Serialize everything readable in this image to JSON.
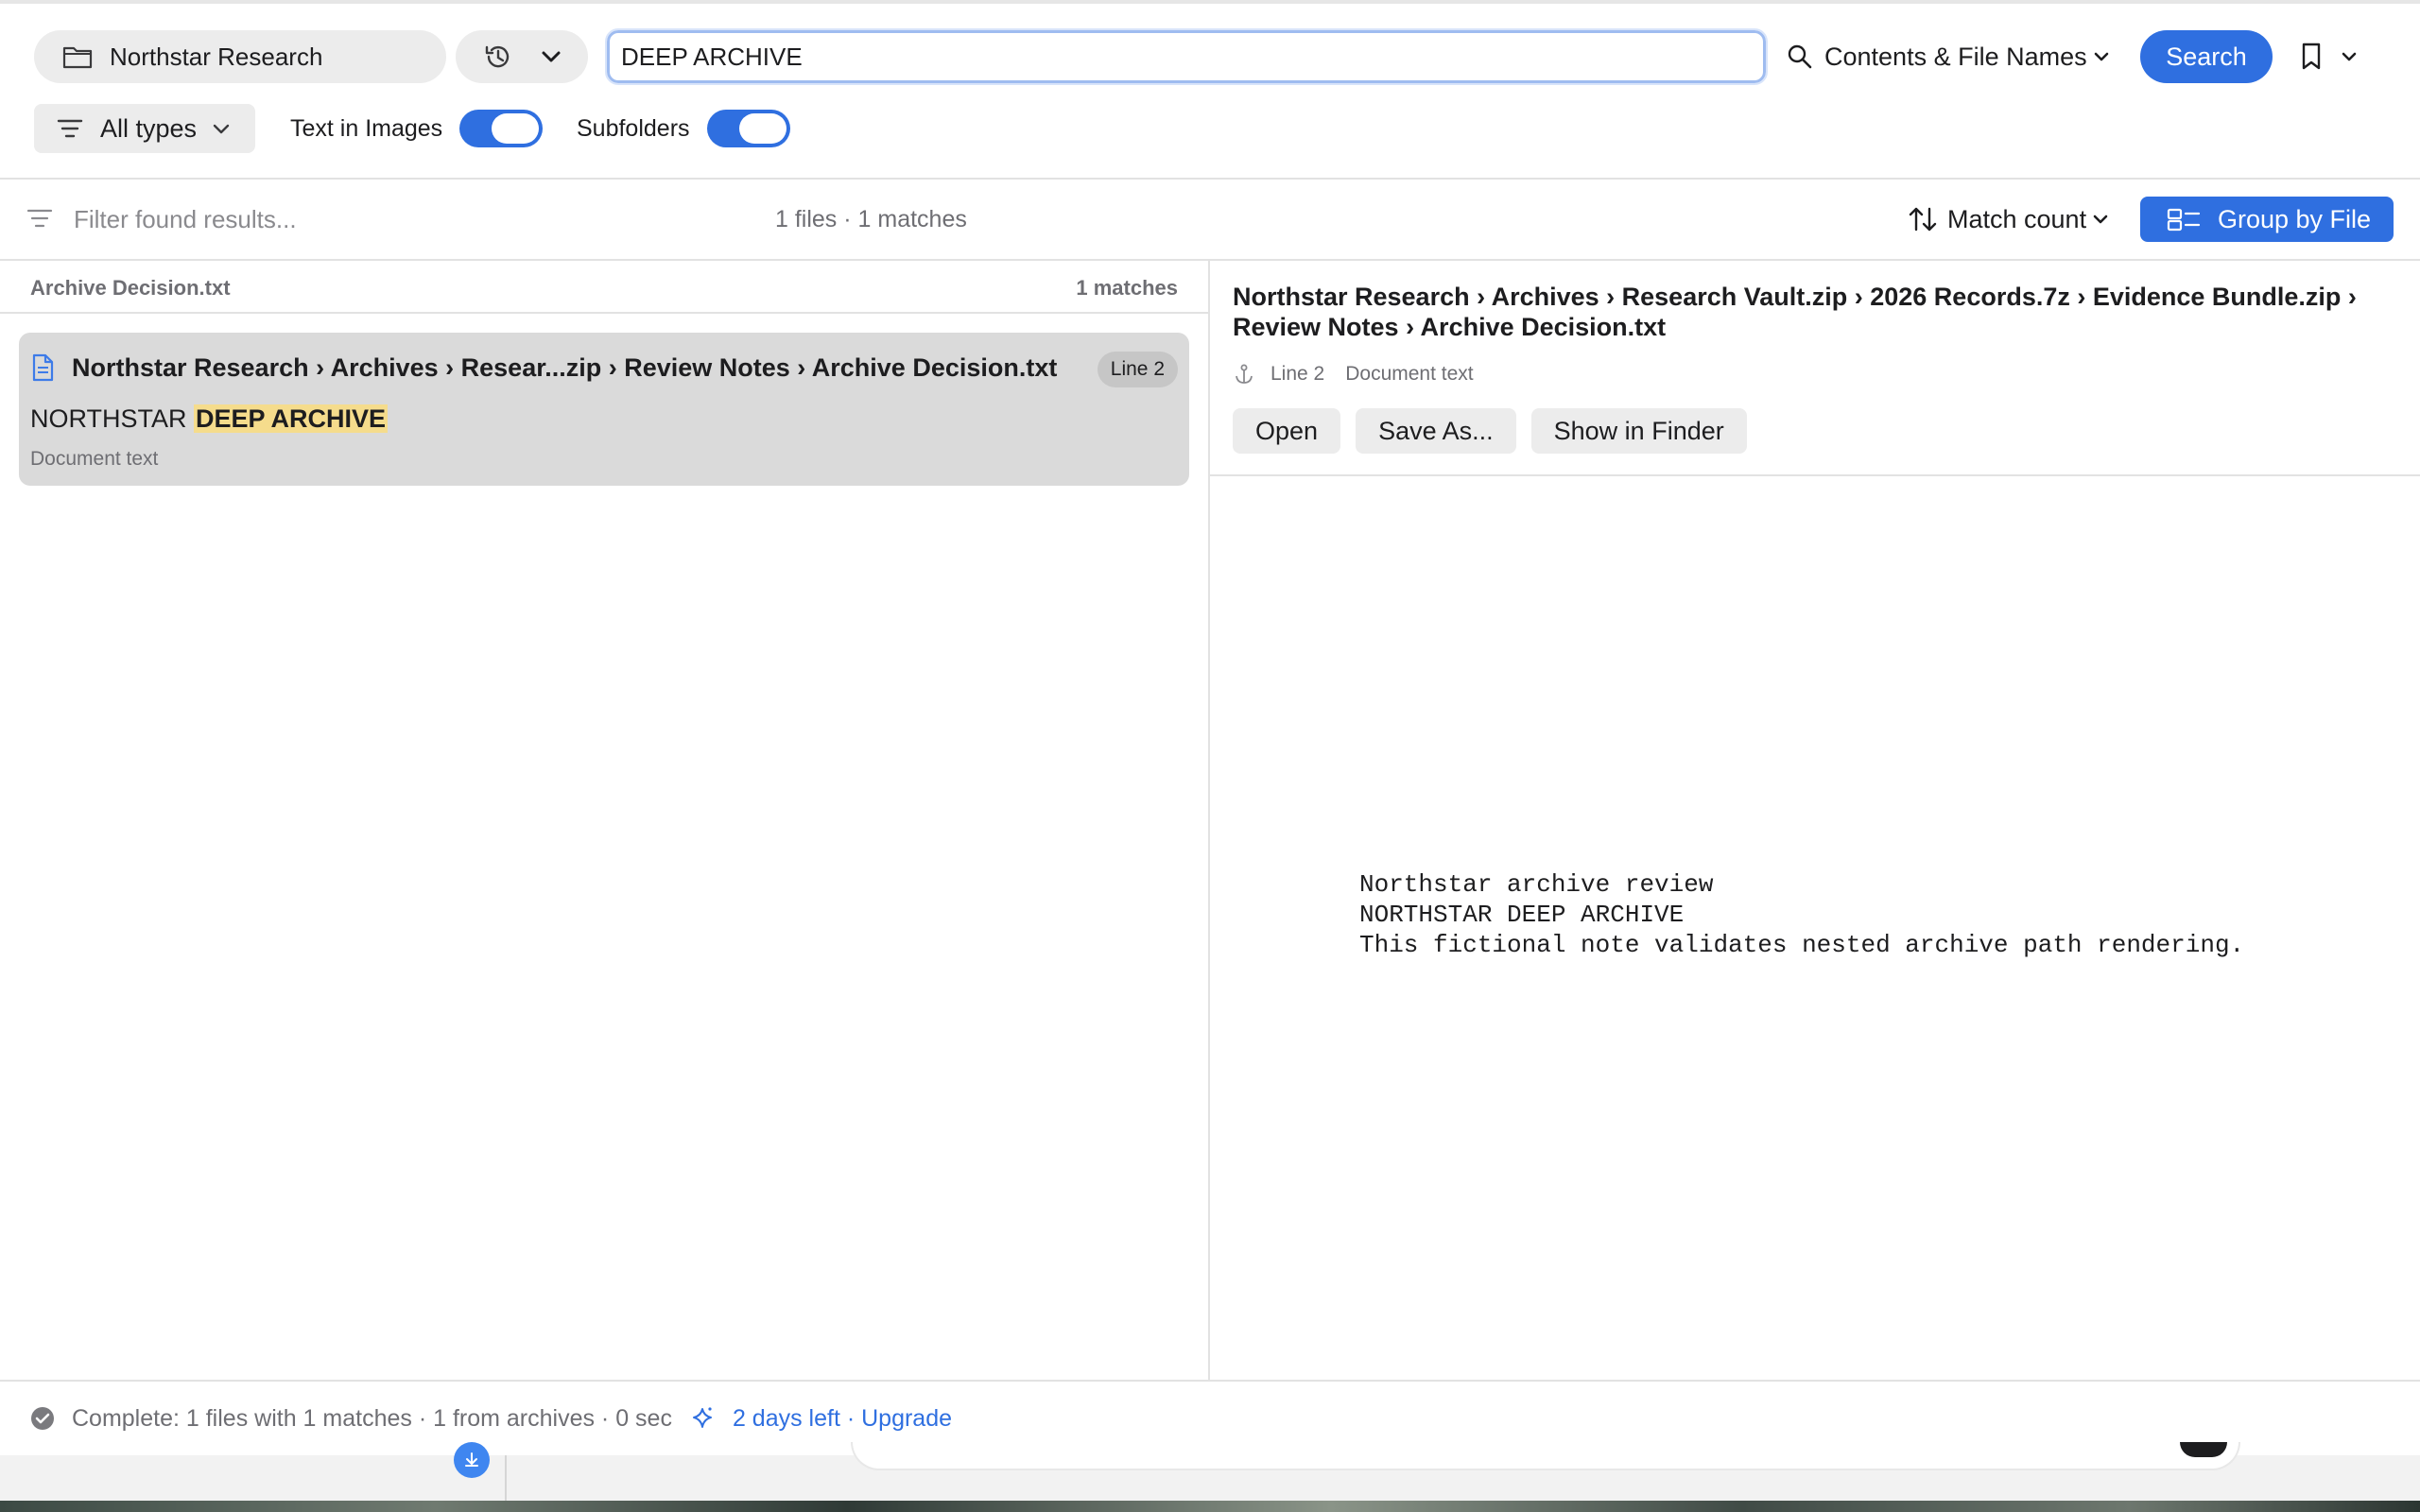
{
  "toolbar": {
    "location": "Northstar Research",
    "search_query": "DEEP ARCHIVE",
    "search_mode": "Contents & File Names",
    "search_button": "Search"
  },
  "options": {
    "types_label": "All types",
    "text_in_images_label": "Text in Images",
    "text_in_images_on": true,
    "subfolders_label": "Subfolders",
    "subfolders_on": true
  },
  "results_bar": {
    "filter_placeholder": "Filter found results...",
    "summary": "1 files · 1 matches",
    "sort_label": "Match count",
    "group_label": "Group by File"
  },
  "results": {
    "group_name": "Archive Decision.txt",
    "group_count": "1 matches",
    "items": [
      {
        "path": "Northstar Research › Archives › Resear...zip › Review Notes › Archive Decision.txt",
        "line_badge": "Line 2",
        "snippet_prefix": "NORTHSTAR ",
        "snippet_highlight": "DEEP ARCHIVE",
        "kind": "Document text"
      }
    ]
  },
  "preview": {
    "path": "Northstar Research › Archives › Research Vault.zip › 2026 Records.7z › Evidence Bundle.zip › Review Notes › Archive Decision.txt",
    "line": "Line 2",
    "kind": "Document text",
    "actions": {
      "open": "Open",
      "save_as": "Save As...",
      "show_in_finder": "Show in Finder"
    },
    "content": "Northstar archive review\nNORTHSTAR DEEP ARCHIVE\nThis fictional note validates nested archive path rendering."
  },
  "status": {
    "text": "Complete: 1 files with 1 matches · 1 from archives · 0 sec",
    "trial": "2 days left · Upgrade"
  },
  "colors": {
    "accent": "#2f6fe0",
    "highlight": "#f5dc8c",
    "selected_row": "#dadada"
  }
}
